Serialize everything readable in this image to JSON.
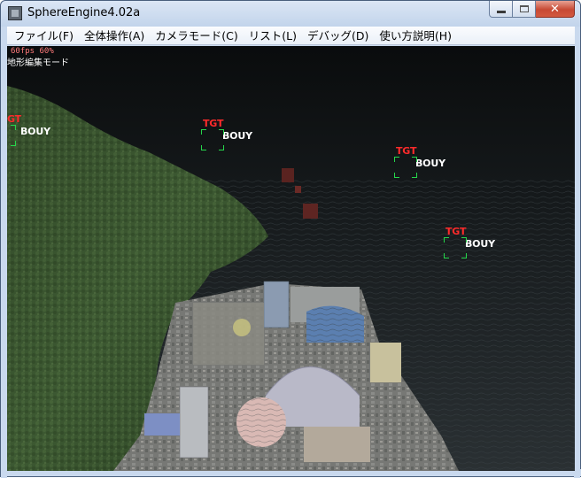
{
  "window": {
    "title": "SphereEngine4.02a",
    "controls": {
      "minimize": "minimize-icon",
      "maximize": "maximize-icon",
      "close": "close-icon",
      "close_glyph": "✕"
    }
  },
  "menu": [
    {
      "label": "ファイル(F)"
    },
    {
      "label": "全体操作(A)"
    },
    {
      "label": "カメラモード(C)"
    },
    {
      "label": "リスト(L)"
    },
    {
      "label": "デバッグ(D)"
    },
    {
      "label": "使い方説明(H)"
    }
  ],
  "hud": {
    "fps": "60fps  60%",
    "mode": "地形編集モード"
  },
  "markers": [
    {
      "tag": "GT",
      "label": "BOUY"
    },
    {
      "tag": "TGT",
      "label": "BOUY"
    },
    {
      "tag": "TGT",
      "label": "BOUY"
    },
    {
      "tag": "TGT",
      "label": "BOUY"
    }
  ],
  "colors": {
    "tag": "#ff2b2b",
    "label": "#ffffff",
    "bracket": "#25d84b",
    "sea": "#1a1f22",
    "hill": "#3d5a2e"
  }
}
